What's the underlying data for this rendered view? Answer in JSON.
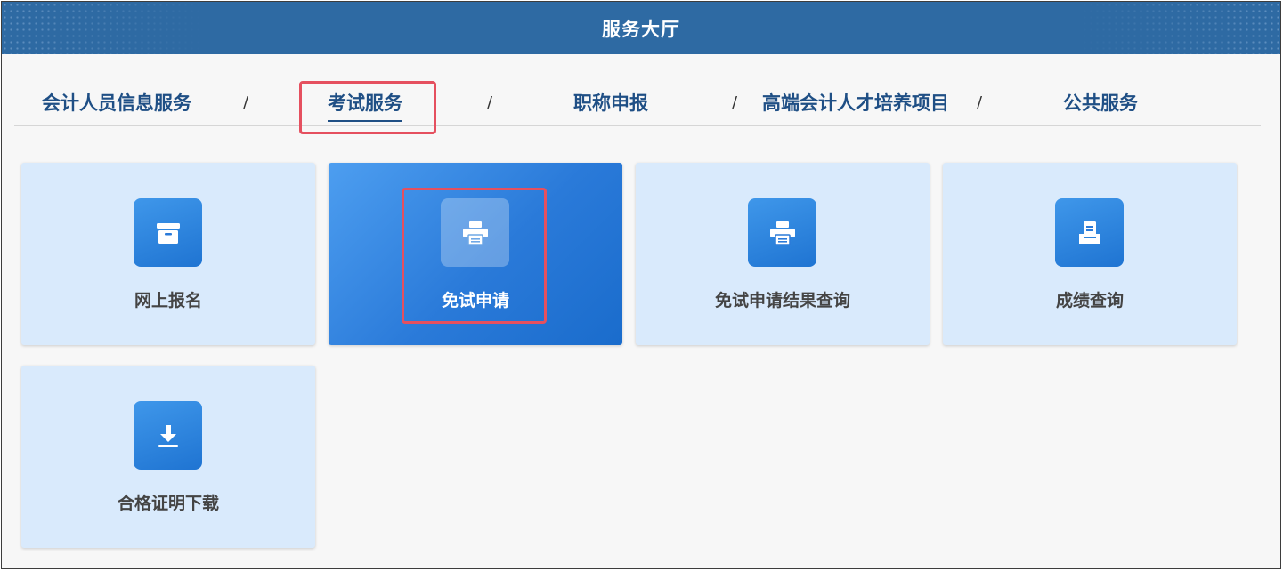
{
  "header": {
    "title": "服务大厅"
  },
  "nav": {
    "items": [
      {
        "label": "会计人员信息服务"
      },
      {
        "label": "考试服务",
        "active": true
      },
      {
        "label": "职称申报"
      },
      {
        "label": "高端会计人才培养项目"
      },
      {
        "label": "公共服务"
      }
    ],
    "separator": "/"
  },
  "cards": [
    {
      "label": "网上报名",
      "icon": "archive-box-icon"
    },
    {
      "label": "免试申请",
      "icon": "printer-icon",
      "selected": true
    },
    {
      "label": "免试申请结果查询",
      "icon": "printer-icon"
    },
    {
      "label": "成绩查询",
      "icon": "document-tray-icon"
    },
    {
      "label": "合格证明下载",
      "icon": "download-icon"
    }
  ],
  "colors": {
    "header_bg": "#2e6aa3",
    "nav_text": "#1f4f85",
    "card_bg": "#d9eafc",
    "card_selected_bg": "#2a7ad9",
    "icon_bg": "#2a84de",
    "highlight": "#e5505f"
  }
}
